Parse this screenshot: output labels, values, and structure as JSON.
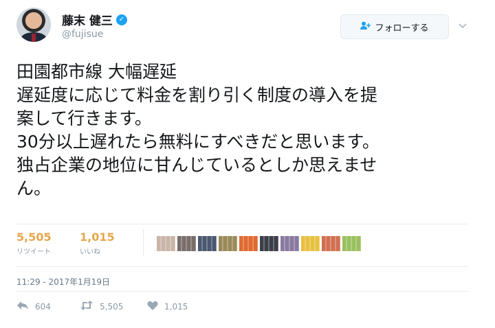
{
  "author": {
    "name": "藤末 健三",
    "handle": "@fujisue",
    "verified_glyph": "✓"
  },
  "follow_button": {
    "label": "フォローする",
    "icon": "person-plus-icon"
  },
  "more_menu": {
    "icon": "chevron-down-icon"
  },
  "tweet": {
    "lines": [
      "田園都市線 大幅遅延",
      "遅延度に応じて料金を割り引く制度の導入を提",
      "案して行きます。",
      "30分以上遅れたら無料にすべきだと思います。",
      "独占企業の地位に甘んじているとしか思えませ",
      "ん。"
    ]
  },
  "stats": {
    "retweets": {
      "count": "5,505",
      "label": "リツイート"
    },
    "likes": {
      "count": "1,015",
      "label": "いいね"
    }
  },
  "likers": {
    "colors": [
      "#c9b6a8",
      "#7a6e6a",
      "#4a5870",
      "#9a8a5a",
      "#e06a30",
      "#3b3f48",
      "#8a7aa0",
      "#e8c040",
      "#d07050",
      "#9ac060"
    ]
  },
  "timestamp": "11:29 - 2017年1月19日",
  "actions": {
    "reply": {
      "count": "604",
      "icon": "reply-icon"
    },
    "retweet": {
      "count": "5,505",
      "icon": "retweet-icon"
    },
    "like": {
      "count": "1,015",
      "icon": "heart-icon"
    }
  }
}
